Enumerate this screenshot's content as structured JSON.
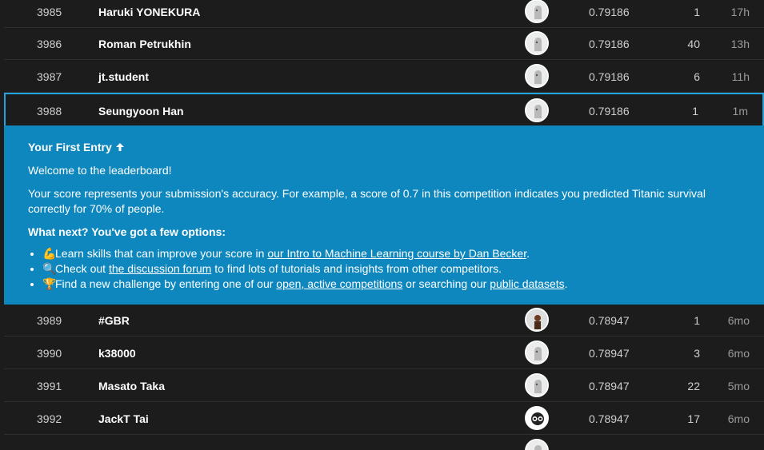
{
  "rows_top": [
    {
      "rank": "3985",
      "team": "Haruki YONEKURA",
      "score": "0.79186",
      "entries": "1",
      "last": "17h"
    },
    {
      "rank": "3986",
      "team": "Roman Petrukhin",
      "score": "0.79186",
      "entries": "40",
      "last": "13h"
    },
    {
      "rank": "3987",
      "team": "jt.student",
      "score": "0.79186",
      "entries": "6",
      "last": "11h"
    },
    {
      "rank": "3988",
      "team": "Seungyoon Han",
      "score": "0.79186",
      "entries": "1",
      "last": "1m"
    }
  ],
  "panel": {
    "heading": "Your First Entry",
    "heading_icon": "arrow-up",
    "welcome": "Welcome to the leaderboard!",
    "score_info": "Your score represents your submission's accuracy. For example, a score of 0.7 in this competition indicates you predicted Titanic survival correctly for 70% of people.",
    "next_title": "What next? You've got a few options:",
    "opt1_pre": "Learn skills that can improve your score in ",
    "opt1_link": "our Intro to Machine Learning course by Dan Becker",
    "opt1_post": ".",
    "opt2_pre": "Check out ",
    "opt2_link": "the discussion forum",
    "opt2_post": " to find lots of tutorials and insights from other competitors.",
    "opt3_pre": "Find a new challenge by entering one of our ",
    "opt3_link1": "open, active competitions",
    "opt3_mid": " or searching our ",
    "opt3_link2": "public datasets",
    "opt3_post": ".",
    "emoji1": "💪",
    "emoji2": "🔍",
    "emoji3": "🏆"
  },
  "rows_bottom": [
    {
      "rank": "3989",
      "team": "#GBR",
      "score": "0.78947",
      "entries": "1",
      "last": "6mo"
    },
    {
      "rank": "3990",
      "team": "k38000",
      "score": "0.78947",
      "entries": "3",
      "last": "6mo"
    },
    {
      "rank": "3991",
      "team": "Masato Taka",
      "score": "0.78947",
      "entries": "22",
      "last": "5mo"
    },
    {
      "rank": "3992",
      "team": "JackT Tai",
      "score": "0.78947",
      "entries": "17",
      "last": "6mo"
    }
  ]
}
